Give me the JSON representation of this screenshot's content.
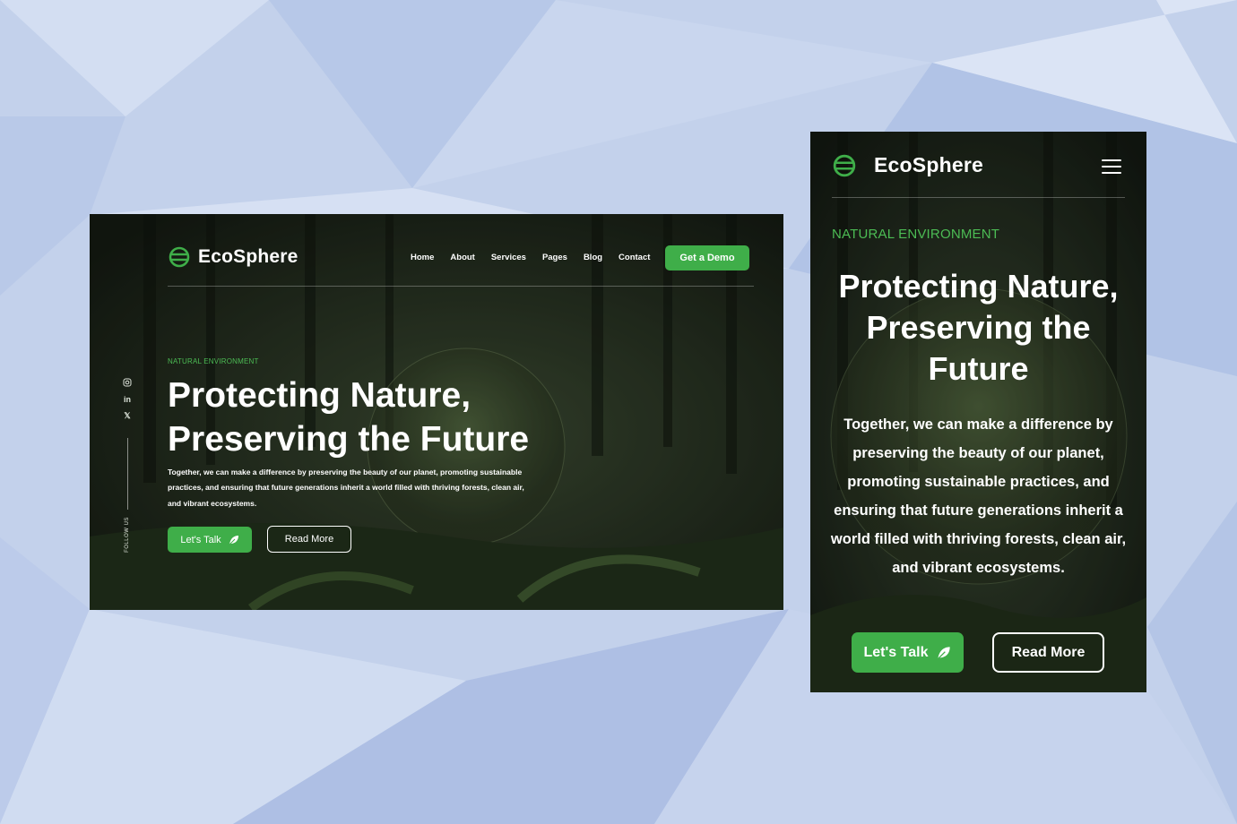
{
  "brand": {
    "name": "EcoSphere",
    "accent": "#3fae49"
  },
  "desktop": {
    "nav": [
      "Home",
      "About",
      "Services",
      "Pages",
      "Blog",
      "Contact"
    ],
    "cta": "Get a Demo",
    "social_icons": [
      "instagram-icon",
      "linkedin-icon",
      "x-icon"
    ],
    "follow_label": "FOLLOW US",
    "eyebrow": "NATURAL ENVIRONMENT",
    "title": "Protecting Nature, Preserving the Future",
    "description": "Together, we can make a difference by preserving the beauty of our planet, promoting sustainable practices, and ensuring that future generations inherit a world filled with thriving forests, clean air, and vibrant ecosystems.",
    "primary_button": "Let's Talk",
    "secondary_button": "Read More"
  },
  "mobile": {
    "menu_icon": "hamburger-menu-icon",
    "eyebrow": "NATURAL ENVIRONMENT",
    "title": "Protecting Nature, Preserving the Future",
    "description": "Together, we can make a difference by preserving the beauty of our planet, promoting sustainable practices, and ensuring that future generations inherit a world filled with thriving forests, clean air, and vibrant ecosystems.",
    "primary_button": "Let's Talk",
    "secondary_button": "Read More"
  }
}
